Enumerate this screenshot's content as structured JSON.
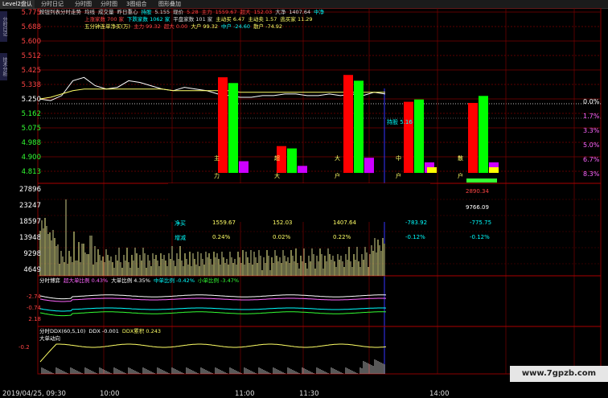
{
  "tabs": [
    "Level2盘认",
    "分时日记",
    "分时图",
    "分时图",
    "3图组合",
    "图形叠加"
  ],
  "side_tabs": [
    "分时日记",
    "技术分析"
  ],
  "header": {
    "line1": [
      {
        "t": "按钮列表分时走势",
        "c": "#dddddd"
      },
      {
        "t": "均线",
        "c": "#dddddd"
      },
      {
        "t": "成交量",
        "c": "#dddddd"
      },
      {
        "t": "昨日重心",
        "c": "#dddddd"
      },
      {
        "t": "持股",
        "c": "#00ffff"
      },
      {
        "t": "5.155",
        "c": "#dddddd"
      },
      {
        "t": "现价",
        "c": "#dddddd"
      },
      {
        "t": "5.28",
        "c": "#ff4444"
      },
      {
        "t": "主力",
        "c": "#ff4444"
      },
      {
        "t": "1559.67",
        "c": "#ff4444"
      },
      {
        "t": "超大",
        "c": "#ff4444"
      },
      {
        "t": "152.03",
        "c": "#ff4444"
      },
      {
        "t": "大净",
        "c": "#dddddd"
      },
      {
        "t": "1407.64",
        "c": "#dddddd"
      },
      {
        "t": "中净",
        "c": "#00ffff"
      }
    ],
    "line2": [
      {
        "t": "上涨家数 700 家",
        "c": "#ff4444"
      },
      {
        "t": "下跌家数 1062 家",
        "c": "#00ffff"
      },
      {
        "t": "平盘家数 101 家",
        "c": "#dddddd"
      },
      {
        "t": "主动买 6.47",
        "c": "#ffff66"
      },
      {
        "t": "主动卖 1.57",
        "c": "#ffff66"
      },
      {
        "t": "逃买家 11.29",
        "c": "#ffff66"
      }
    ],
    "line3": [
      {
        "t": "五分钟连单净买(万)",
        "c": "#ffff66"
      },
      {
        "t": "主力 99.32",
        "c": "#ff4444"
      },
      {
        "t": "超大 0.00",
        "c": "#ff4444"
      },
      {
        "t": "大户 99.32",
        "c": "#ffff66"
      },
      {
        "t": "中户 -24.60",
        "c": "#00ffff"
      },
      {
        "t": "散户 -74.92",
        "c": "#ffff66"
      }
    ]
  },
  "price_axis_left": [
    "5.775",
    "5.688",
    "5.600",
    "5.512",
    "5.425",
    "5.338",
    "5.250",
    "5.162",
    "5.075",
    "4.988",
    "4.900",
    "4.813"
  ],
  "pct_axis_right": [
    {
      "t": "0.0%",
      "c": "#ff4444"
    },
    {
      "t": "1.7%",
      "c": "#ff4444"
    },
    {
      "t": "3.3%",
      "c": "#ff4444"
    },
    {
      "t": "5.0%",
      "c": "#ff4444"
    },
    {
      "t": "6.7%",
      "c": "#ff4444"
    },
    {
      "t": "8.3%",
      "c": "#ff4444"
    }
  ],
  "vol_axis_left": [
    "27896",
    "23247",
    "18597",
    "13948",
    "9298",
    "4649"
  ],
  "bar_group_labels": [
    {
      "t": "主",
      "sub": "力"
    },
    {
      "t": "超",
      "sub": "大"
    },
    {
      "t": "大",
      "sub": "户"
    },
    {
      "t": "中",
      "sub": "户"
    },
    {
      "t": "散",
      "sub": "户"
    }
  ],
  "hold_label": "持股 5.16",
  "table": {
    "hidden_value": "2890.34",
    "side_value": "9766.09",
    "rows": [
      {
        "label": "净买",
        "values": [
          "1559.67",
          "152.03",
          "1407.64",
          "-783.92",
          "-775.75"
        ]
      },
      {
        "label": "增减",
        "values": [
          "0.24%",
          "0.02%",
          "0.22%",
          "-0.12%",
          "-0.12%"
        ]
      }
    ]
  },
  "indicator1": {
    "title": "分时博弈",
    "items": [
      {
        "t": "超大单比例 0.43%",
        "c": "#ff66ff"
      },
      {
        "t": "大单比例 4.35%",
        "c": "#ffffff"
      },
      {
        "t": "中单比例 -0.42%",
        "c": "#00ffff"
      },
      {
        "t": "小单比例 -3.47%",
        "c": "#33ff33"
      }
    ],
    "axis": [
      "-2.74",
      "-0.74",
      "2.18"
    ]
  },
  "indicator2": {
    "title": "分时DDX(60,5,10)",
    "items": [
      {
        "t": "DDX -0.001",
        "c": "#ffffff"
      },
      {
        "t": "DDX累积 0.243",
        "c": "#ffff66"
      }
    ],
    "sub": "大单动向",
    "axis": [
      "-0.2"
    ]
  },
  "time_axis": [
    "2019/04/25, 09:30",
    "10:00",
    "11:00",
    "11:30",
    "14:00"
  ],
  "watermark": "www.7gpzb.com",
  "chart_data": {
    "type": "bar",
    "categories": [
      "主力",
      "超大",
      "大户",
      "中户",
      "散户"
    ],
    "series": [
      {
        "name": "",
        "values": [
          8.2,
          2.3,
          8.4,
          6.1,
          6.0
        ],
        "color": "#ff0000"
      },
      {
        "name": "",
        "values": [
          7.7,
          2.1,
          7.9,
          6.3,
          6.6
        ],
        "color": "#00ff00"
      },
      {
        "name": "",
        "values": [
          1.0,
          0.6,
          1.3,
          0.9,
          0.9
        ],
        "color": "#cc00ff"
      }
    ],
    "price_series": [
      5.25,
      5.24,
      5.27,
      5.36,
      5.38,
      5.33,
      5.31,
      5.32,
      5.36,
      5.35,
      5.33,
      5.31,
      5.3,
      5.32,
      5.31,
      5.3,
      5.28,
      5.27,
      5.26,
      5.26,
      5.27,
      5.27,
      5.28,
      5.28,
      5.27,
      5.27,
      5.28,
      5.27,
      5.28,
      5.27,
      5.29,
      5.28
    ],
    "avg_series": [
      5.25,
      5.26,
      5.28,
      5.3,
      5.31,
      5.31,
      5.31,
      5.31,
      5.31,
      5.31,
      5.31,
      5.31,
      5.3,
      5.3,
      5.3,
      5.3,
      5.3,
      5.3,
      5.29,
      5.29,
      5.29,
      5.29,
      5.29,
      5.29,
      5.29,
      5.29,
      5.29,
      5.29,
      5.29,
      5.29,
      5.29,
      5.29
    ],
    "ylim": [
      4.813,
      5.775
    ]
  }
}
